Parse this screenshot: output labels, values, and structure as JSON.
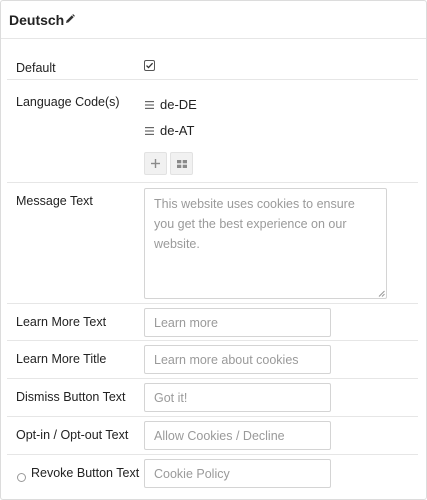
{
  "panel": {
    "title": "Deutsch"
  },
  "fields": {
    "default_label": "Default",
    "default_checked": true,
    "language_codes_label": "Language Code(s)",
    "language_codes": [
      "de-DE",
      "de-AT"
    ],
    "message_text_label": "Message Text",
    "message_text_placeholder": "This website uses cookies to ensure you get the best experience on our website.",
    "learn_more_text_label": "Learn More Text",
    "learn_more_text_placeholder": "Learn more",
    "learn_more_title_label": "Learn More Title",
    "learn_more_title_placeholder": "Learn more about cookies",
    "dismiss_button_label": "Dismiss Button Text",
    "dismiss_button_placeholder": "Got it!",
    "opt_in_out_label": "Opt-in / Opt-out Text",
    "opt_in_out_placeholder": "Allow Cookies / Decline",
    "revoke_button_label": "Revoke Button Text",
    "revoke_button_placeholder": "Cookie Policy"
  },
  "icons": {
    "edit": "pencil-icon",
    "checkbox": "checkbox-checked-icon",
    "drag": "drag-handle-icon",
    "add": "plus-icon",
    "grid": "grid-icon",
    "radio": "radio-icon"
  }
}
